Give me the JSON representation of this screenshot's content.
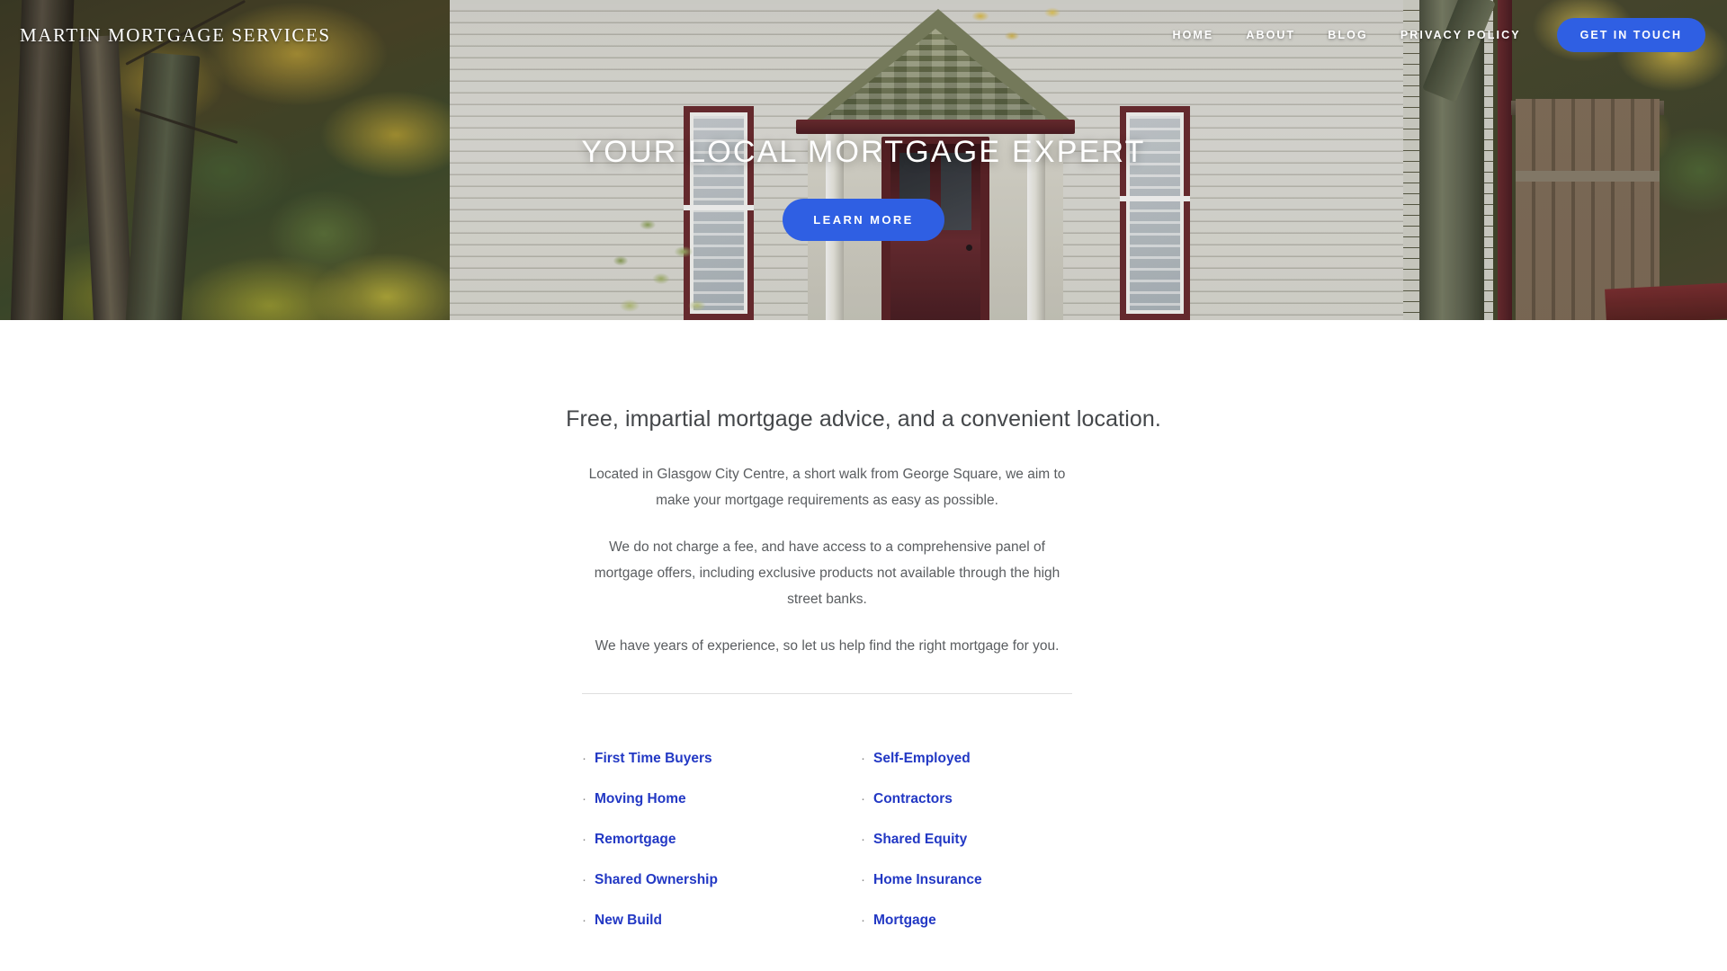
{
  "site": {
    "logo": "MARTIN MORTGAGE SERVICES"
  },
  "nav": {
    "items": [
      {
        "label": "HOME"
      },
      {
        "label": "ABOUT"
      },
      {
        "label": "BLOG"
      },
      {
        "label": "PRIVACY POLICY"
      }
    ],
    "cta_label": "GET IN TOUCH"
  },
  "hero": {
    "title": "YOUR LOCAL MORTGAGE EXPERT",
    "cta_label": "LEARN MORE",
    "image_alt": "white clapboard house with dark red trim, mossy shingled porch gable and autumn foliage"
  },
  "intro": {
    "heading": "Free, impartial mortgage advice, and a convenient location.",
    "paragraphs": [
      "Located in Glasgow City Centre, a short walk from George Square, we aim to make your mortgage requirements as easy as possible.",
      "We do not charge a fee, and have access to a comprehensive panel of mortgage offers, including exclusive products not available through the high street banks.",
      "We have years of experience, so let us help find the right mortgage for you."
    ]
  },
  "services": {
    "bullet_glyph": "·",
    "left_column": [
      {
        "label": "First Time Buyers"
      },
      {
        "label": "Moving Home"
      },
      {
        "label": "Remortgage"
      },
      {
        "label": "Shared Ownership"
      },
      {
        "label": "New Build"
      }
    ],
    "right_column": [
      {
        "label": "Self-Employed"
      },
      {
        "label": "Contractors"
      },
      {
        "label": "Shared Equity"
      },
      {
        "label": "Home Insurance"
      },
      {
        "label": "Mortgage"
      }
    ]
  },
  "colors": {
    "accent_blue": "#2f5fe3",
    "link_blue": "#2238c4",
    "body_text": "#5a5d60",
    "heading_text": "#44474a",
    "divider": "#dedede"
  }
}
